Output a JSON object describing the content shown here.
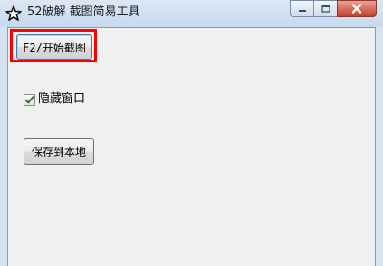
{
  "window": {
    "title": "52破解 截图简易工具"
  },
  "main": {
    "capture_button_label": "F2/开始截图",
    "hide_window_label": "隐藏窗口",
    "hide_window_checked": true,
    "save_button_label": "保存到本地"
  },
  "icons": {
    "app": "star-icon",
    "minimize": "minimize-icon",
    "maximize": "maximize-icon",
    "close": "close-icon",
    "check": "check-icon"
  },
  "colors": {
    "highlight": "#ff0000",
    "check": "#2f6f1f"
  }
}
